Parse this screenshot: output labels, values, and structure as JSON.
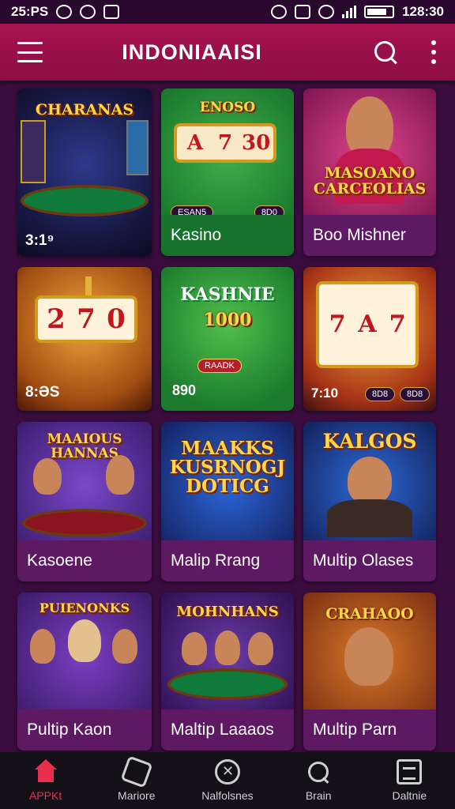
{
  "status_bar": {
    "time_left": "25:PS",
    "time_right": "128:30"
  },
  "app_bar": {
    "title": "INDONIAAISI"
  },
  "cards": [
    {
      "label": "",
      "art_title": "CHARANAS",
      "badge": "3:1⁹"
    },
    {
      "label": "Kasino",
      "art_title": "ENOSO",
      "reels": [
        "A",
        "7",
        "30"
      ],
      "pill_left": "ESAN5",
      "pill_right": "8D0"
    },
    {
      "label": "Boo Mishner",
      "art_title": "MASOANO CARCEOLIAS"
    },
    {
      "label": "",
      "reels": [
        "2",
        "7",
        "0"
      ],
      "badge": "8:ƏS"
    },
    {
      "label": "",
      "art_title": "KASHNIE",
      "coins": "1000",
      "pill_center": "RAADK",
      "badge": "890"
    },
    {
      "label": "",
      "reels": [
        "7",
        "A",
        "7"
      ],
      "badge": "7:10",
      "pill_left": "8D8",
      "pill_right": "8D8"
    },
    {
      "label": "Kasoene",
      "art_title": "MAAIOUS HANNAS"
    },
    {
      "label": "Malip Rrang",
      "art_title": "MAAKKS KUSRNOGJ DOTICG"
    },
    {
      "label": "Multip Olases",
      "art_title": "KALGOS"
    },
    {
      "label": "Pultip Kaon",
      "art_title": "PUIENONKS"
    },
    {
      "label": "Maltip Laaaos",
      "art_title": "MOHNHANS"
    },
    {
      "label": "Multip Parn",
      "art_title": "CRAHAOO"
    }
  ],
  "bottom_nav": [
    {
      "label": "APPKt",
      "icon": "home-icon",
      "active": true
    },
    {
      "label": "Mariore",
      "icon": "dice-icon",
      "active": false
    },
    {
      "label": "Nalfolsnes",
      "icon": "compass-icon",
      "active": false
    },
    {
      "label": "Brain",
      "icon": "search-icon",
      "active": false
    },
    {
      "label": "Daltnie",
      "icon": "document-icon",
      "active": false
    }
  ],
  "colors": {
    "app_bar": "#a8124f",
    "background": "#3a0d3e",
    "card_label_bg": "#5d1a63",
    "nav_active": "#e7304b"
  }
}
